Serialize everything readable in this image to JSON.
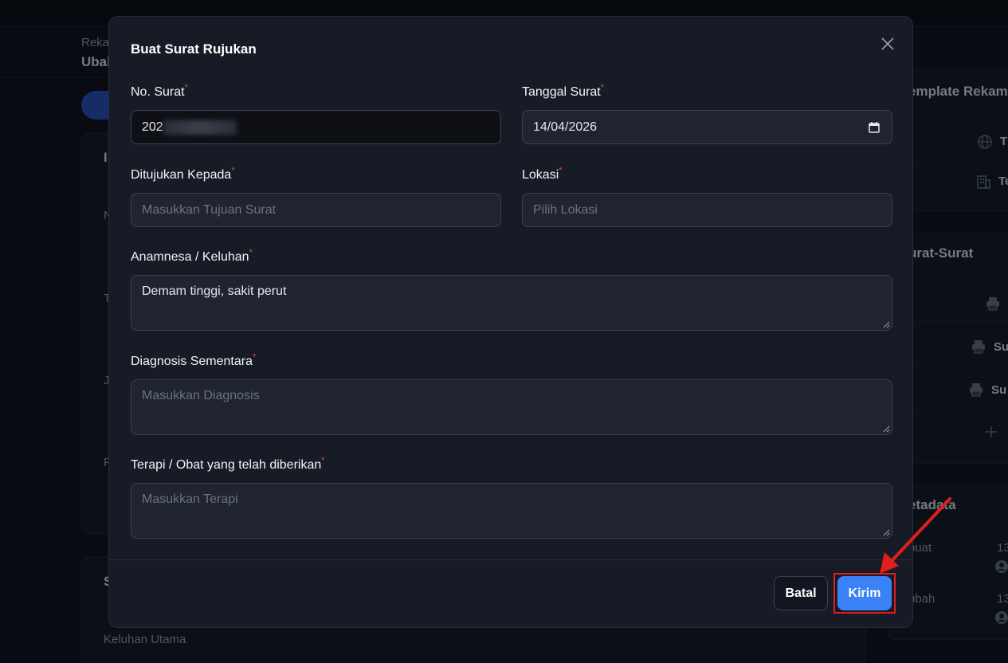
{
  "background": {
    "breadcrumb": "Reka",
    "title": "Ubal",
    "right_panel": {
      "template_heading": "emplate Rekam",
      "template_item1": "T",
      "template_item2": "Te",
      "surat_heading": "urat-Surat",
      "surat_item2": "Su",
      "surat_item3": "Su",
      "metadata_heading": "etadata",
      "meta_dibuat_label": "buat",
      "meta_dibuat_value": "13",
      "meta_diubah_label": "ubah",
      "meta_diubah_value": "13"
    },
    "left_fragments": [
      "I",
      "N",
      "T",
      "J",
      "P",
      "S"
    ],
    "keluhan_utama_label": "Keluhan Utama"
  },
  "modal": {
    "title": "Buat Surat Rujukan",
    "fields": {
      "no_surat": {
        "label": "No. Surat",
        "value": "202"
      },
      "tanggal_surat": {
        "label": "Tanggal Surat",
        "value": "14/04/2026"
      },
      "ditujukan_kepada": {
        "label": "Ditujukan Kepada",
        "placeholder": "Masukkan Tujuan Surat"
      },
      "lokasi": {
        "label": "Lokasi",
        "placeholder": "Pilih Lokasi"
      },
      "anamnesa": {
        "label": "Anamnesa / Keluhan",
        "value": "Demam tinggi, sakit perut"
      },
      "diagnosis": {
        "label": "Diagnosis Sementara",
        "placeholder": "Masukkan Diagnosis"
      },
      "terapi": {
        "label": "Terapi / Obat yang telah diberikan",
        "placeholder": "Masukkan Terapi"
      }
    },
    "required_mark": "*",
    "buttons": {
      "cancel": "Batal",
      "submit": "Kirim"
    }
  },
  "colors": {
    "accent": "#3b82f6",
    "required": "#ef4444",
    "annotation": "#e11d1d",
    "modal_bg": "#161b26"
  },
  "icons": [
    "close-icon",
    "calendar-icon",
    "resize-handle-icon",
    "globe-icon",
    "building-icon",
    "printer-icon",
    "plus-icon",
    "user-icon"
  ]
}
